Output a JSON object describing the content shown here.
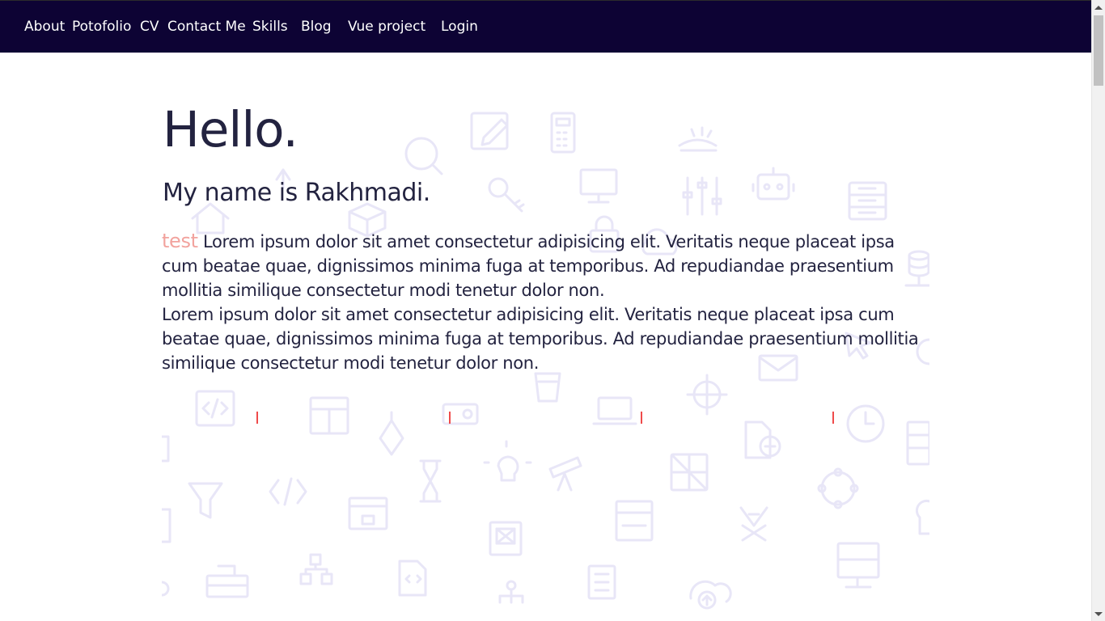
{
  "nav": {
    "links": [
      "About",
      "Potofolio",
      "CV",
      "Contact Me",
      "Skills",
      "Blog",
      "Vue project",
      "Login"
    ]
  },
  "hero": {
    "title": "Hello.",
    "subtitle": "My name is Rakhmadi.",
    "accent_word": "test",
    "paragraph_line1": "Lorem ipsum dolor sit amet consectetur adipisicing elit. Veritatis neque placeat ipsa cum beatae quae, dignissimos minima fuga at temporibus. Ad repudiandae praesentium mollitia similique consectetur modi tenetur dolor non.",
    "paragraph_line2": "Lorem ipsum dolor sit amet consectetur adipisicing elit. Veritatis neque placeat ipsa cum beatae quae, dignissimos minima fuga at temporibus. Ad repudiandae praesentium mollitia similique consectetur modi tenetur dolor non."
  },
  "colors": {
    "navbar_bg": "#0d0334",
    "text": "#232340",
    "accent": "#f2a39e",
    "marker": "#ef4b4b",
    "pattern": "#e8e6f7"
  },
  "background_icons": [
    "edit-icon",
    "calculator-icon",
    "search-icon",
    "key-icon",
    "monitor-icon",
    "sliders-icon",
    "robot-icon",
    "server-icon",
    "database-icon",
    "code-icon",
    "layout-icon",
    "projector-icon",
    "laptop-icon",
    "target-icon",
    "clock-icon",
    "file-add-icon",
    "filter-icon",
    "hourglass-icon",
    "bulb-icon",
    "telescope-icon",
    "browser-lock-icon",
    "image-icon",
    "sitemap-icon",
    "cloud-upload-icon",
    "mail-icon",
    "cursor-icon"
  ]
}
